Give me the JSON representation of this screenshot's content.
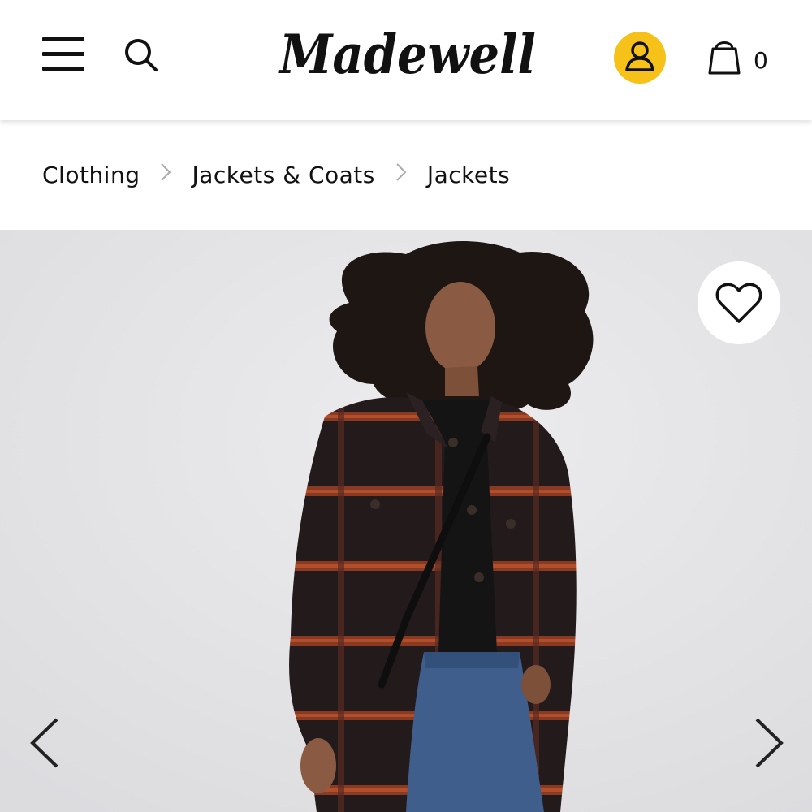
{
  "header": {
    "logo_text": "Madewell",
    "cart_count": "0"
  },
  "breadcrumb": [
    {
      "label": "Clothing"
    },
    {
      "label": "Jackets & Coats"
    },
    {
      "label": "Jackets"
    }
  ],
  "icons": {
    "menu": "hamburger-menu-icon",
    "search": "search-icon",
    "account": "user-icon",
    "cart": "shopping-bag-icon",
    "wishlist": "heart-icon",
    "prev": "chevron-left-icon",
    "next": "chevron-right-icon"
  },
  "colors": {
    "accent_yellow": "#f6c21a",
    "hero_background": "#e4e4e6",
    "text": "#111111"
  }
}
